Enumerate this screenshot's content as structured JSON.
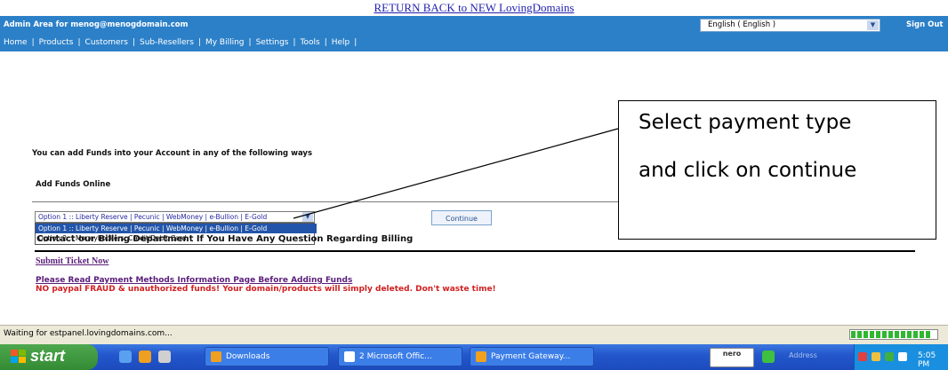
{
  "banner": {
    "return_link": "RETURN BACK to NEW LovingDomains"
  },
  "header": {
    "admin_area": "Admin Area for menog@menogdomain.com",
    "language": "English ( English )",
    "sign_out": "Sign Out",
    "nav": [
      "Home",
      "Products",
      "Customers",
      "Sub-Resellers",
      "My Billing",
      "Settings",
      "Tools",
      "Help"
    ]
  },
  "main": {
    "intro": "You can add Funds into your Account in any of the following ways",
    "add_funds_title": "Add Funds Online",
    "payment_select_value": "Option 1 :: Liberty Reserve | Pecunic | WebMoney | e-Bullion | E-Gold",
    "payment_options": [
      "Option 1 :: Liberty Reserve | Pecunic | WebMoney | e-Bullion | E-Gold",
      "Option 2 :: Moneybookers, Credit/Debit Card"
    ],
    "continue_label": "Continue",
    "contact_text": "Contact our Billing Department If You Have Any Question Regarding Billing",
    "submit_ticket": "Submit Ticket Now",
    "read_payment": "Please Read Payment Methods Information Page Before Adding Funds",
    "fraud_warning": "NO paypal FRAUD & unauthorized funds! Your domain/products will simply deleted. Don't waste time!"
  },
  "callout": {
    "line1": "Select payment type",
    "line2": "and click on continue"
  },
  "browser_status": {
    "text": "Waiting for estpanel.lovingdomains.com...",
    "progress": 0.95
  },
  "taskbar": {
    "start": "start",
    "tasks": [
      "Downloads",
      "2 Microsoft Offic...",
      "Payment Gateway..."
    ],
    "nero": "nero",
    "address_label": "Address",
    "clock": "5:05 PM"
  },
  "colors": {
    "header_blue": "#2c80c8",
    "taskbar_blue": "#2457cc",
    "start_green": "#338a33",
    "warning_red": "#d02020"
  }
}
